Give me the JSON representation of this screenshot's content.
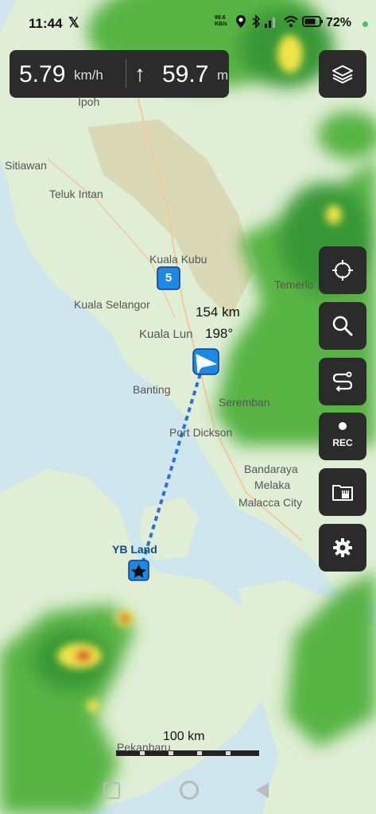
{
  "status_bar": {
    "time": "11:44",
    "x_icon": "x-logo-icon",
    "net_speed_value": "99.6",
    "net_speed_unit": "KB/s",
    "battery": "72%"
  },
  "speed_panel": {
    "speed": "5.79",
    "speed_unit": "km/h",
    "altitude": "59.7",
    "altitude_unit": "m",
    "arrow_icon": "arrow-up-icon"
  },
  "toolbar": {
    "layers_icon": "layers-icon",
    "locate_icon": "crosshair-icon",
    "search_icon": "search-icon",
    "route_icon": "route-icon",
    "rec_label": "REC",
    "files_icon": "sd-card-folder-icon",
    "settings_icon": "gear-icon"
  },
  "map": {
    "places": [
      "Sitiawan",
      "Teluk Intan",
      "Kuala Kubu",
      "Kuala Selangor",
      "Kuala Lun",
      "Banting",
      "Seremban",
      "Port Dickson",
      "Bandaraya",
      "Melaka",
      "Malacca City",
      "Temerlo",
      "Ipoh",
      "Pekanbaru"
    ],
    "distance_label": "154 km",
    "bearing_label": "198°",
    "cluster_count": "5",
    "poi_label": "YB Land",
    "poi_icon": "star-icon",
    "current_position_icon": "navigation-arrow-icon",
    "scale_label": "100 km",
    "radar_colors": {
      "light": "#7cd35a",
      "mid": "#3faa2a",
      "dark": "#1f8a1a",
      "yellow": "#f2e34a",
      "red": "#d8271e"
    },
    "route_color": "#2f6fd8",
    "sea_color": "#cfe6ee",
    "land_color": "#dfeed5"
  },
  "navigation_bar": {
    "recents_icon": "recents-icon",
    "home_icon": "home-icon",
    "back_icon": "back-icon"
  }
}
